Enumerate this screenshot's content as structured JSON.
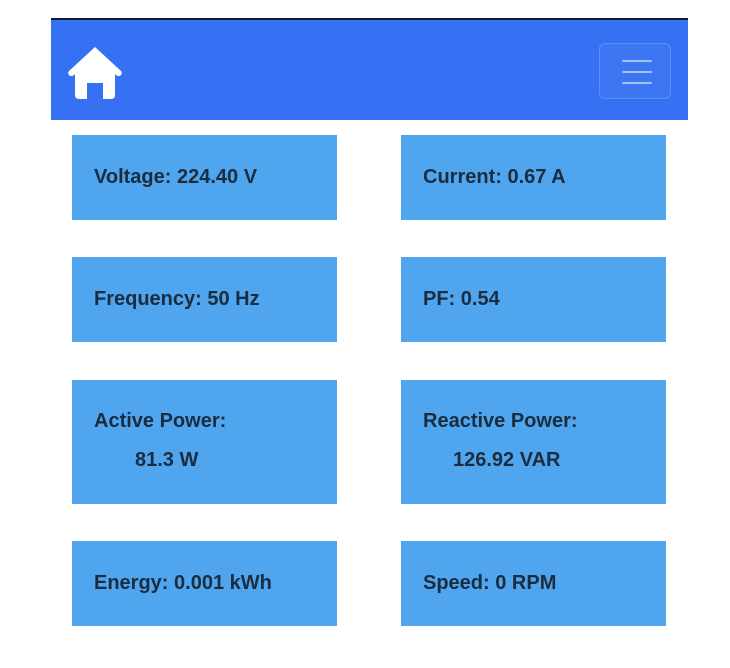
{
  "navbar": {
    "home_icon": "home-icon",
    "menu_icon": "hamburger-menu-icon",
    "color": "#3571f2"
  },
  "cards": {
    "voltage": "Voltage: 224.40 V",
    "current": "Current: 0.67 A",
    "frequency": "Frequency: 50 Hz",
    "pf": "PF: 0.54",
    "active_power_label": "Active Power:",
    "active_power_value": "81.3 W",
    "reactive_power_label": "Reactive Power:",
    "reactive_power_value": "126.92 VAR",
    "energy": "Energy: 0.001 kWh",
    "speed": "Speed: 0 RPM"
  },
  "colors": {
    "card_bg": "#4fa6ee",
    "card_text": "#1b2c3f"
  }
}
